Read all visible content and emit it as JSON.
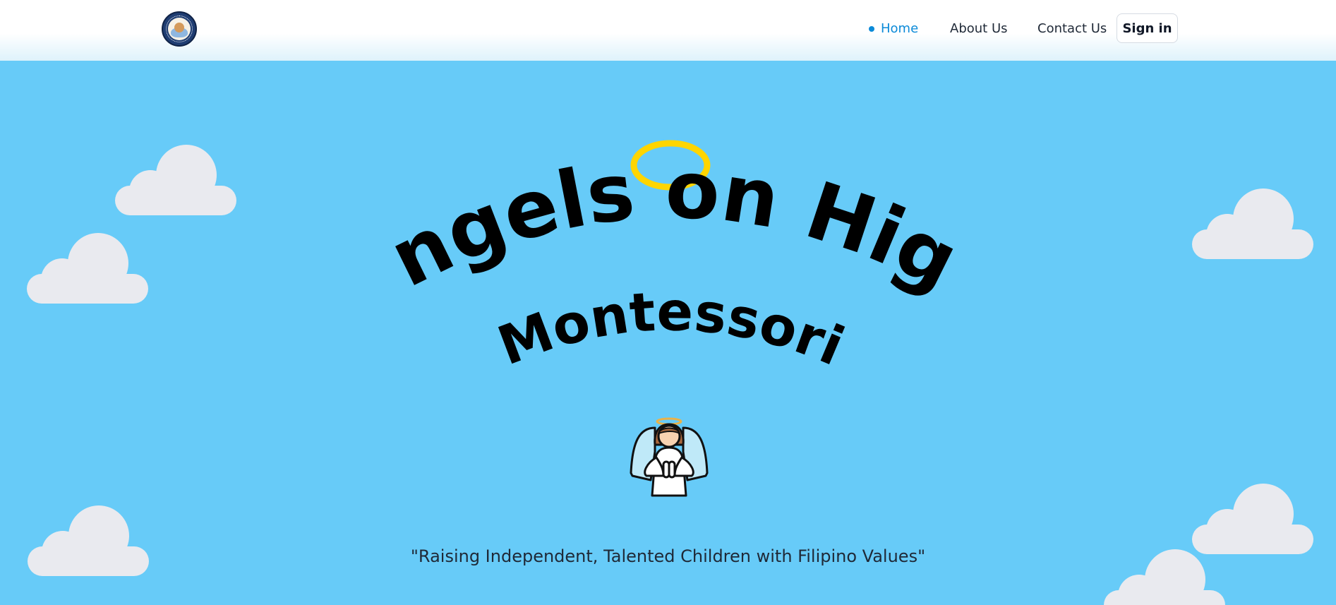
{
  "nav": {
    "logo_alt": "Angels on High Montessori logo",
    "home_label": "Home",
    "about_label": "About Us",
    "contact_label": "Contact Us",
    "signin_label": "Sign in",
    "active_color": "#0b8ad8"
  },
  "hero": {
    "title_line1": "Angels on High",
    "title_line2": "Montessori",
    "tagline": "\"Raising Independent, Talented Children with Filipino Values\"",
    "background_color": "#67cbf8",
    "halo_color": "#ffd500",
    "cloud_color": "#e9eaef"
  },
  "icons": {
    "halo": "halo-icon",
    "angel": "praying-angel-icon",
    "cloud": "cloud-icon"
  }
}
